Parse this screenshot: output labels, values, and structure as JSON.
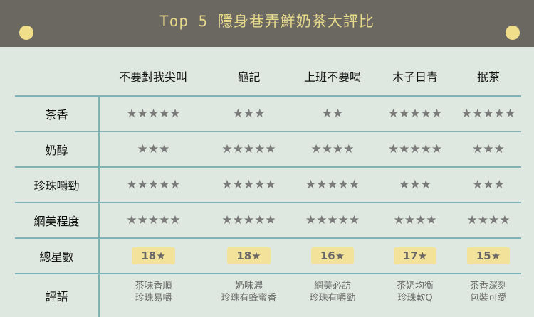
{
  "header": {
    "title": "Top 5 隱身巷弄鮮奶茶大評比"
  },
  "columns": [
    "不要對我尖叫",
    "龜記",
    "上班不要喝",
    "木子日青",
    "抿茶"
  ],
  "rows": [
    {
      "label": "茶香",
      "stars": [
        "★★★★★",
        "★★★",
        "★★",
        "★★★★★",
        "★★★★★"
      ]
    },
    {
      "label": "奶醇",
      "stars": [
        "★★★",
        "★★★★★",
        "★★★★",
        "★★★★★",
        "★★★"
      ]
    },
    {
      "label": "珍珠嚼勁",
      "stars": [
        "★★★★★",
        "★★★★★",
        "★★★★★",
        "★★★",
        "★★★"
      ]
    },
    {
      "label": "網美程度",
      "stars": [
        "★★★★★",
        "★★★★★",
        "★★★★★",
        "★★★★",
        "★★★★"
      ]
    }
  ],
  "total": {
    "label": "總星數",
    "values": [
      "18★",
      "18★",
      "16★",
      "17★",
      "15★"
    ]
  },
  "comments": {
    "label": "評語",
    "values": [
      [
        "茶味香順",
        "珍珠易嚼"
      ],
      [
        "奶味濃",
        "珍珠有蜂蜜香"
      ],
      [
        "網美必訪",
        "珍珠有嚼勁"
      ],
      [
        "茶奶均衡",
        "珍珠軟Q"
      ],
      [
        "茶香深刻",
        "包裝可愛"
      ]
    ]
  },
  "colors": {
    "header_bg": "#6b6862",
    "title": "#e5d889",
    "accent_dot": "#f0de8a",
    "grid": "#7fb1b6",
    "badge": "#f3e39a"
  }
}
